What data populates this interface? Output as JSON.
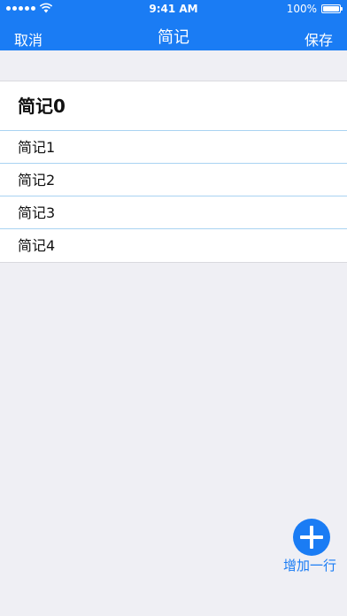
{
  "status_bar": {
    "time": "9:41 AM",
    "battery_percent": "100%",
    "signal_icon": "signal-dots-icon",
    "wifi_icon": "wifi-icon",
    "battery_icon": "battery-icon"
  },
  "nav": {
    "left_label": "取消",
    "title": "简记",
    "right_label": "保存"
  },
  "notes": [
    {
      "text": "简记0"
    },
    {
      "text": "简记1"
    },
    {
      "text": "简记2"
    },
    {
      "text": "简记3"
    },
    {
      "text": "简记4"
    }
  ],
  "add_row": {
    "icon": "plus-icon",
    "label": "增加一行"
  },
  "colors": {
    "accent": "#1a7cf4",
    "background": "#efeff4",
    "row_separator": "#a9d3f2"
  }
}
